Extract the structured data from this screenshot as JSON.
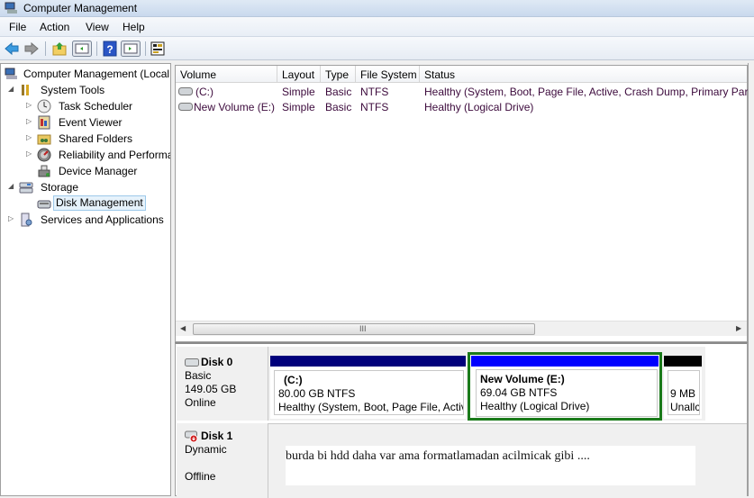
{
  "window": {
    "title": "Computer Management"
  },
  "menu": [
    "File",
    "Action",
    "View",
    "Help"
  ],
  "toolbar": {
    "buttons": [
      "back-icon",
      "forward-icon",
      "up-folder-icon",
      "show-hide-console-tree-icon",
      "help-icon",
      "show-hide-action-pane-icon",
      "properties-icon"
    ]
  },
  "tree": {
    "root": "Computer Management (Local",
    "items": [
      {
        "label": "System Tools",
        "level": 1,
        "expander": "expanded",
        "icon": "tools-icon"
      },
      {
        "label": "Task Scheduler",
        "level": 2,
        "expander": "collapsed",
        "icon": "clock-icon"
      },
      {
        "label": "Event Viewer",
        "level": 2,
        "expander": "collapsed",
        "icon": "event-viewer-icon"
      },
      {
        "label": "Shared Folders",
        "level": 2,
        "expander": "collapsed",
        "icon": "shared-folder-icon"
      },
      {
        "label": "Reliability and Performa",
        "level": 2,
        "expander": "collapsed",
        "icon": "performance-icon"
      },
      {
        "label": "Device Manager",
        "level": 2,
        "expander": "none",
        "icon": "device-manager-icon"
      },
      {
        "label": "Storage",
        "level": 1,
        "expander": "expanded",
        "icon": "storage-icon"
      },
      {
        "label": "Disk Management",
        "level": 2,
        "expander": "none",
        "icon": "disk-management-icon",
        "selected": true
      },
      {
        "label": "Services and Applications",
        "level": 1,
        "expander": "collapsed",
        "icon": "services-icon"
      }
    ]
  },
  "volumes": {
    "columns": [
      "Volume",
      "Layout",
      "Type",
      "File System",
      "Status"
    ],
    "rows": [
      {
        "volume": "(C:)",
        "layout": "Simple",
        "type": "Basic",
        "fs": "NTFS",
        "status": "Healthy (System, Boot, Page File, Active, Crash Dump, Primary Partit"
      },
      {
        "volume": "New Volume (E:)",
        "layout": "Simple",
        "type": "Basic",
        "fs": "NTFS",
        "status": "Healthy (Logical Drive)"
      }
    ],
    "scroll_glyph": "III"
  },
  "disks": [
    {
      "name": "Disk 0",
      "type": "Basic",
      "size": "149.05 GB",
      "state": "Online",
      "partitions": [
        {
          "label": "(C:)",
          "size": "80.00 GB NTFS",
          "status": "Healthy (System, Boot, Page File, Activ",
          "color": "#00007b"
        },
        {
          "label": "New Volume  (E:)",
          "size": "69.04 GB NTFS",
          "status": "Healthy (Logical Drive)",
          "color": "#0000ff",
          "selected": true
        },
        {
          "label": "",
          "size": "9 MB",
          "status": "Unallc",
          "color": "#000000"
        }
      ]
    },
    {
      "name": "Disk 1",
      "type": "Dynamic",
      "size": "",
      "state": "Offline",
      "note": "burda bi hdd daha var ama formatlamadan acilmicak gibi ...."
    }
  ],
  "colors": {
    "selection_border": "#1a7a1a",
    "primary_partition": "#00007b",
    "logical_drive": "#0000ff",
    "unallocated": "#000000"
  }
}
